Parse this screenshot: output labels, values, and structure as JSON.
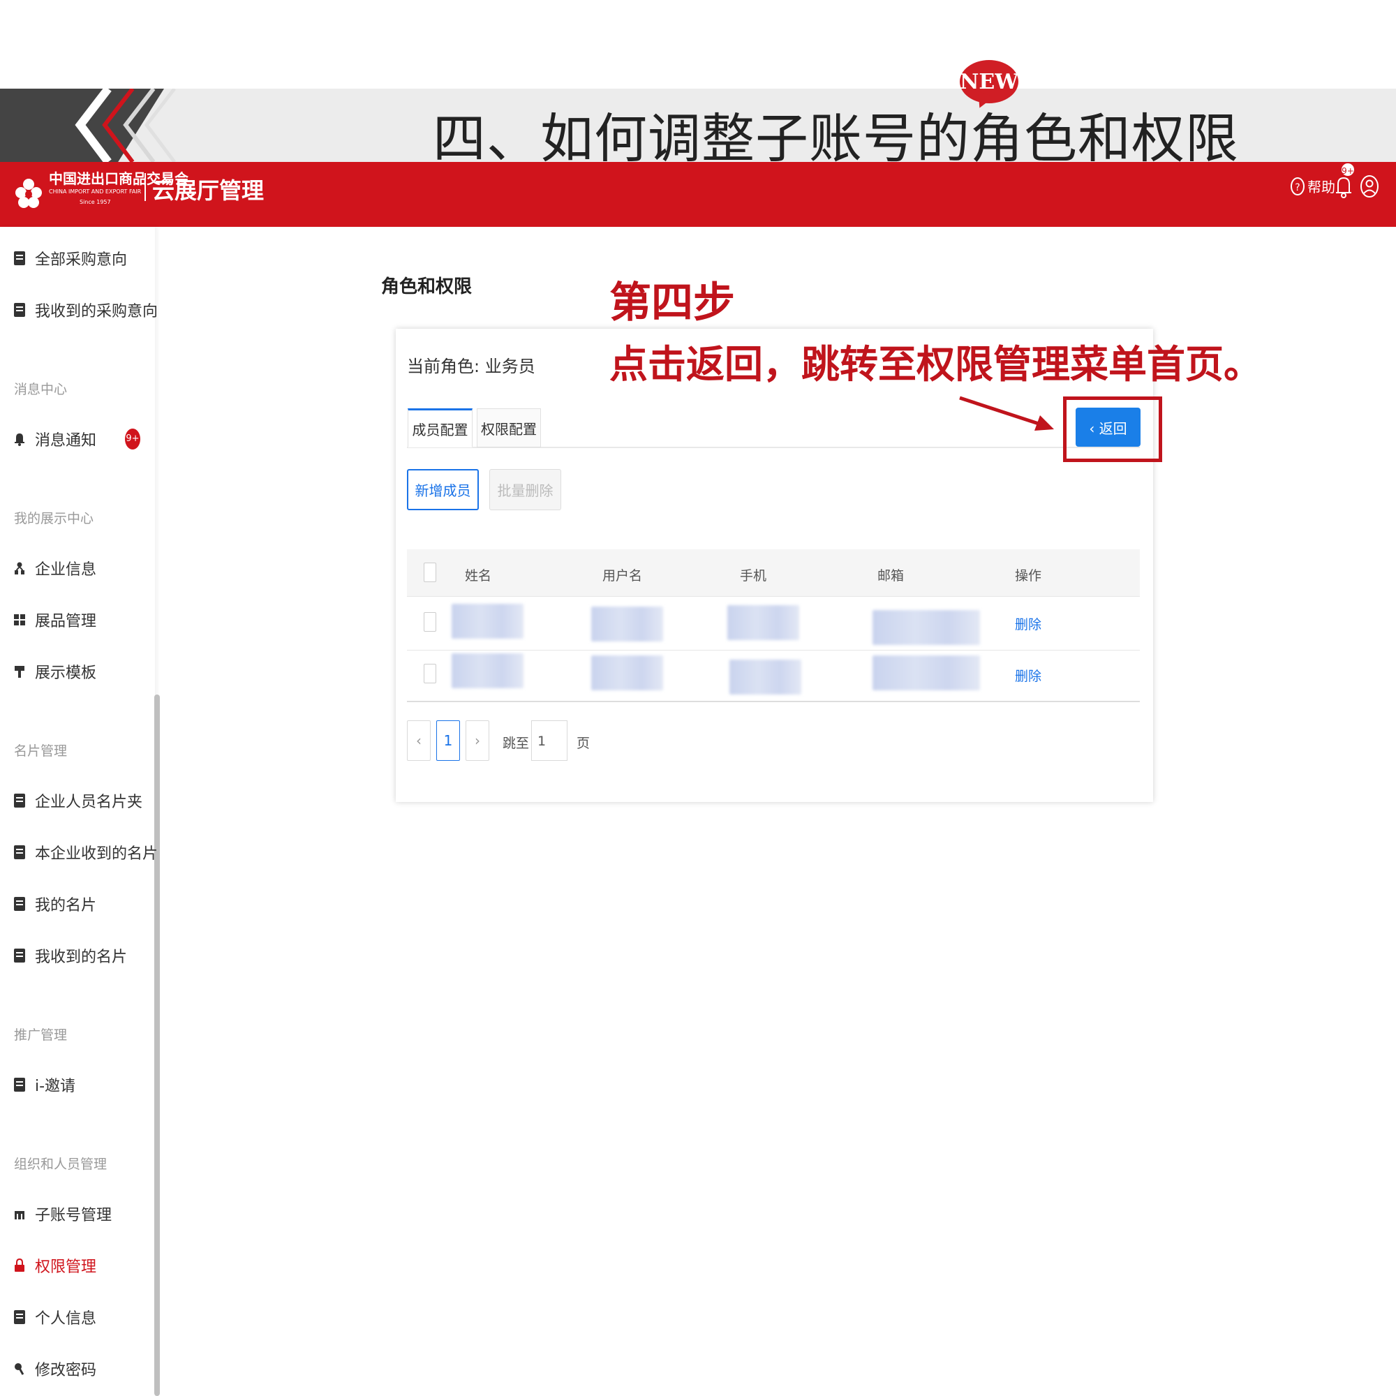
{
  "slide": {
    "title": "四、如何调整子账号的角色和权限",
    "new_badge": "NEW"
  },
  "header": {
    "logo_cn": "中国进出口商品交易会",
    "logo_en": "CHINA IMPORT AND EXPORT FAIR",
    "logo_since": "Since 1957",
    "app_title": "云展厅管理",
    "help_label": "帮助",
    "notification_badge": "9+"
  },
  "sidebar": {
    "items": [
      {
        "label": "全部采购意向",
        "icon": "document-icon"
      },
      {
        "label": "我收到的采购意向",
        "icon": "document-icon"
      },
      {
        "section": "消息中心"
      },
      {
        "label": "消息通知",
        "icon": "bell-icon",
        "badge": "9+"
      },
      {
        "section": "我的展示中心"
      },
      {
        "label": "企业信息",
        "icon": "org-icon"
      },
      {
        "label": "展品管理",
        "icon": "grid-icon"
      },
      {
        "label": "展示模板",
        "icon": "brush-icon"
      },
      {
        "section": "名片管理"
      },
      {
        "label": "企业人员名片夹",
        "icon": "card-icon"
      },
      {
        "label": "本企业收到的名片",
        "icon": "card-icon"
      },
      {
        "label": "我的名片",
        "icon": "card-icon"
      },
      {
        "label": "我收到的名片",
        "icon": "card-icon"
      },
      {
        "section": "推广管理"
      },
      {
        "label": "i-邀请",
        "icon": "invite-icon"
      },
      {
        "section": "组织和人员管理"
      },
      {
        "label": "子账号管理",
        "icon": "account-icon"
      },
      {
        "label": "权限管理",
        "icon": "lock-icon",
        "active": true
      },
      {
        "label": "个人信息",
        "icon": "document-icon"
      },
      {
        "label": "修改密码",
        "icon": "key-icon"
      }
    ],
    "active_color": "#d0141c"
  },
  "main": {
    "page_title": "角色和权限",
    "current_role": "当前角色: 业务员",
    "tabs": [
      {
        "label": "成员配置",
        "active": true
      },
      {
        "label": "权限配置",
        "active": false
      }
    ],
    "back_button": "‹ 返回",
    "add_member_button": "新增成员",
    "batch_delete_button": "批量删除",
    "table": {
      "columns": [
        "姓名",
        "用户名",
        "手机",
        "邮箱",
        "操作"
      ],
      "rows": [
        {
          "action": "删除"
        },
        {
          "action": "删除"
        }
      ]
    },
    "pagination": {
      "prev": "‹",
      "current_page": "1",
      "next": "›",
      "jump_label": "跳至",
      "jump_value": "1",
      "unit": "页"
    }
  },
  "annotation": {
    "step_title": "第四步",
    "step_desc": "点击返回，跳转至权限管理菜单首页。",
    "color": "#c0141c"
  },
  "colors": {
    "brand_red": "#d0141c",
    "accent_blue": "#1a73e8"
  }
}
